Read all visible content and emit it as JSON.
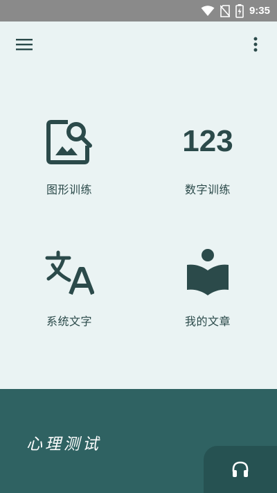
{
  "status_bar": {
    "time": "9:35",
    "icons": [
      "wifi-icon",
      "no-sim-icon",
      "battery-charging-icon"
    ]
  },
  "app_bar": {
    "menu_icon": "hamburger-menu-icon",
    "overflow_icon": "more-vert-icon"
  },
  "tiles": [
    {
      "label": "图形训练",
      "icon": "image-search-icon"
    },
    {
      "label": "数字训练",
      "icon": "numbers-123-icon",
      "icon_text": "123"
    },
    {
      "label": "系统文字",
      "icon": "translate-icon"
    },
    {
      "label": "我的文章",
      "icon": "reading-person-icon"
    }
  ],
  "bottom": {
    "title": "心理测试",
    "tab_icon": "headset-icon"
  },
  "colors": {
    "background": "#eaf3f3",
    "accent": "#2f6262",
    "icon": "#2b4a4a",
    "status_bar": "#8a8a8a"
  }
}
